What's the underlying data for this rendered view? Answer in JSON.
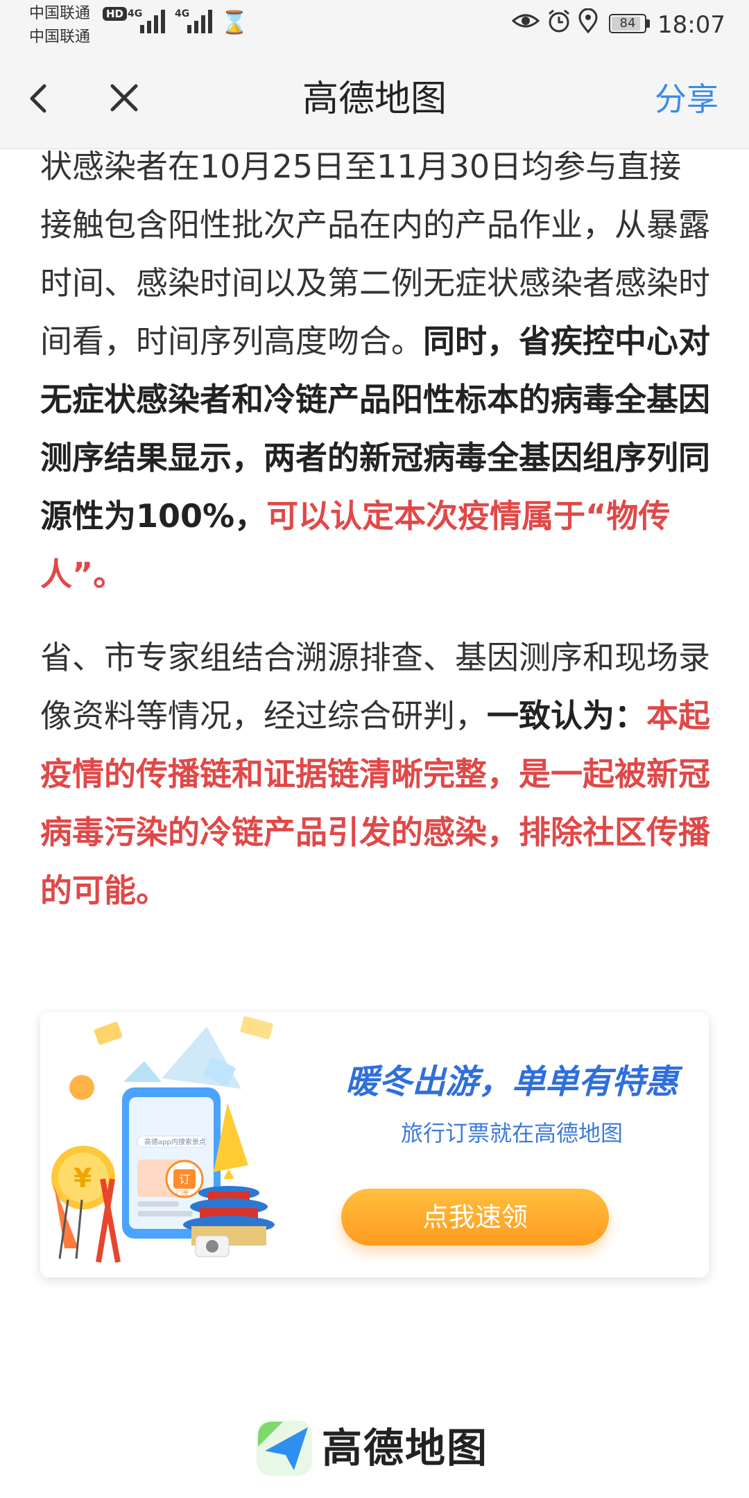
{
  "status_bar": {
    "carrier_1": "中国联通",
    "carrier_2": "中国联通",
    "hd_badge": "HD",
    "network_1": "4G",
    "network_2": "4G",
    "battery": "84",
    "time": "18:07"
  },
  "nav": {
    "title": "高德地图",
    "share_label": "分享"
  },
  "article": {
    "p1_normal": "状感染者在10月25日至11月30日均参与直接接触包含阳性批次产品在内的产品作业，从暴露时间、感染时间以及第二例无症状感染者感染时间看，时间序列高度吻合。",
    "p1_bold": "同时，省疾控中心对无症状感染者和冷链产品阳性标本的病毒全基因测序结果显示，两者的新冠病毒全基因组序列同源性为100%，",
    "p1_red": "可以认定本次疫情属于“物传人”。",
    "p2_normal": "省、市专家组结合溯源排查、基因测序和现场录像资料等情况，经过综合研判，",
    "p2_bold": "一致认为：",
    "p2_red": "本起疫情的传播链和证据链清晰完整，是一起被新冠病毒污染的冷链产品引发的感染，排除社区传播的可能。"
  },
  "ad": {
    "headline": "暖冬出游，单单有特惠",
    "subtitle": "旅行订票就在高德地图",
    "button_label": "点我速领",
    "phone_search_text": "高德app内搜索景点",
    "ticket_label": "订",
    "ticket_sub": "门票",
    "coin_symbol": "¥"
  },
  "footer": {
    "brand_name": "高德地图"
  },
  "colors": {
    "accent_blue": "#3b8be5",
    "highlight_red": "#e04848",
    "ad_button_orange": "#ff9b1f",
    "ad_headline_blue": "#2f6fdc"
  }
}
